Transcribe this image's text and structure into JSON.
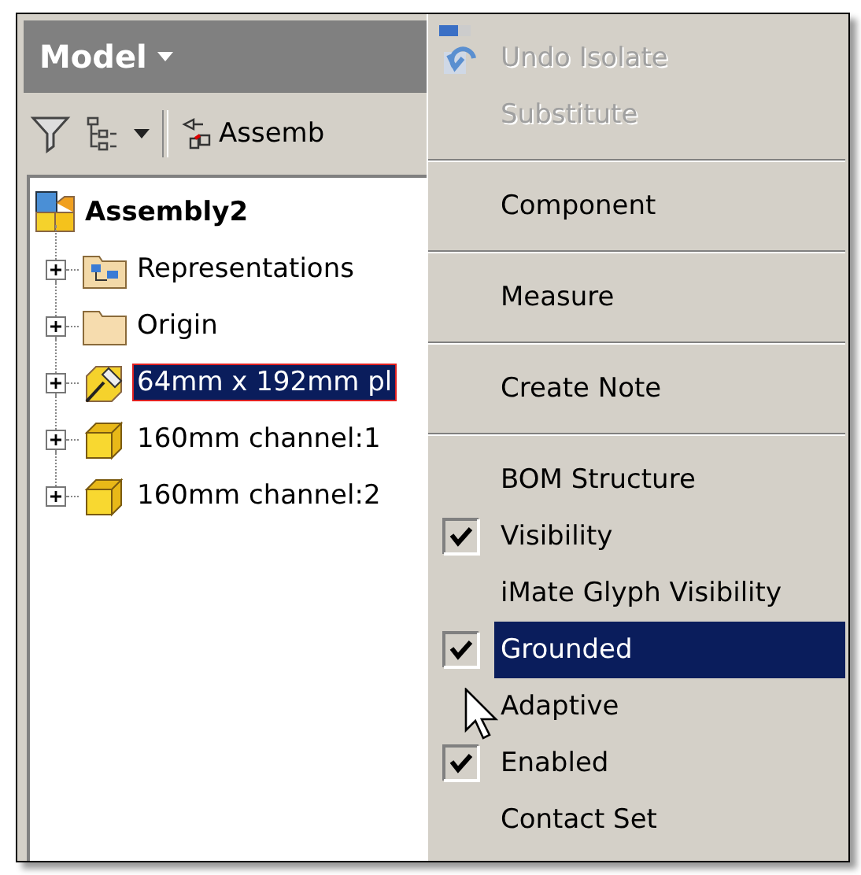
{
  "browser": {
    "title": "Model",
    "toolbar": {
      "label": "Assemb"
    },
    "tree": {
      "label": "Assembly2",
      "children": [
        {
          "label": "Representations",
          "kind": "representations",
          "expanded": false,
          "selected": false
        },
        {
          "label": "Origin",
          "kind": "folder",
          "expanded": false,
          "selected": false
        },
        {
          "label": "64mm x 192mm pl",
          "kind": "grounded-part",
          "expanded": false,
          "selected": true
        },
        {
          "label": "160mm channel:1",
          "kind": "part",
          "expanded": false,
          "selected": false
        },
        {
          "label": "160mm channel:2",
          "kind": "part",
          "expanded": false,
          "selected": false
        }
      ]
    }
  },
  "context_menu": {
    "items": [
      {
        "kind": "undo-item",
        "label": "Undo Isolate",
        "disabled": true,
        "selected": false
      },
      {
        "kind": "item",
        "label": "Substitute",
        "disabled": true,
        "selected": false
      },
      {
        "kind": "separator"
      },
      {
        "kind": "item",
        "label": "Component",
        "disabled": false,
        "selected": false
      },
      {
        "kind": "separator"
      },
      {
        "kind": "item",
        "label": "Measure",
        "disabled": false,
        "selected": false
      },
      {
        "kind": "separator"
      },
      {
        "kind": "item",
        "label": "Create Note",
        "disabled": false,
        "selected": false
      },
      {
        "kind": "separator"
      },
      {
        "kind": "item",
        "label": "BOM Structure",
        "disabled": false,
        "selected": false
      },
      {
        "kind": "check",
        "label": "Visibility",
        "checked": true,
        "selected": false
      },
      {
        "kind": "check",
        "label": "iMate Glyph Visibility",
        "checked": false,
        "selected": false
      },
      {
        "kind": "check",
        "label": "Grounded",
        "checked": true,
        "selected": true
      },
      {
        "kind": "check",
        "label": "Adaptive",
        "checked": false,
        "selected": false
      },
      {
        "kind": "check",
        "label": "Enabled",
        "checked": true,
        "selected": false
      },
      {
        "kind": "item",
        "label": "Contact Set",
        "disabled": false,
        "selected": false
      }
    ]
  }
}
